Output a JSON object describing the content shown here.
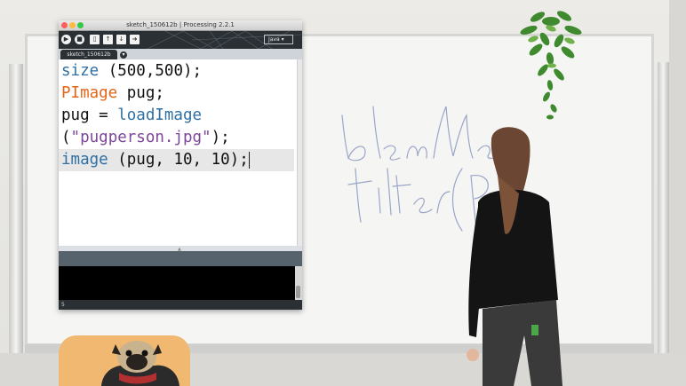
{
  "window": {
    "title": "sketch_150612b | Processing 2.2.1",
    "tab_label": "sketch_150612b",
    "mode": "Java ▾",
    "line_number": "5"
  },
  "toolbar": {
    "run": "▶",
    "stop": "■",
    "new": "▯",
    "open": "↑",
    "save": "↓",
    "export": "➜"
  },
  "code": {
    "l1_fn": "size",
    "l1_rest": " (500,500);",
    "l2_type": "PImage",
    "l2_rest": " pug;",
    "l3_pre": "pug = ",
    "l3_fn": "loadImage",
    "l4_pre": "(",
    "l4_str": "\"pugperson.jpg\"",
    "l4_post": ");",
    "l5_fn": "image",
    "l5_rest": " (pug, 10, 10);"
  },
  "colors": {
    "function_keyword": "#2f6fa3",
    "type_keyword": "#e2661a",
    "string_literal": "#7d4698",
    "toolbar_bg": "#2b3035"
  }
}
